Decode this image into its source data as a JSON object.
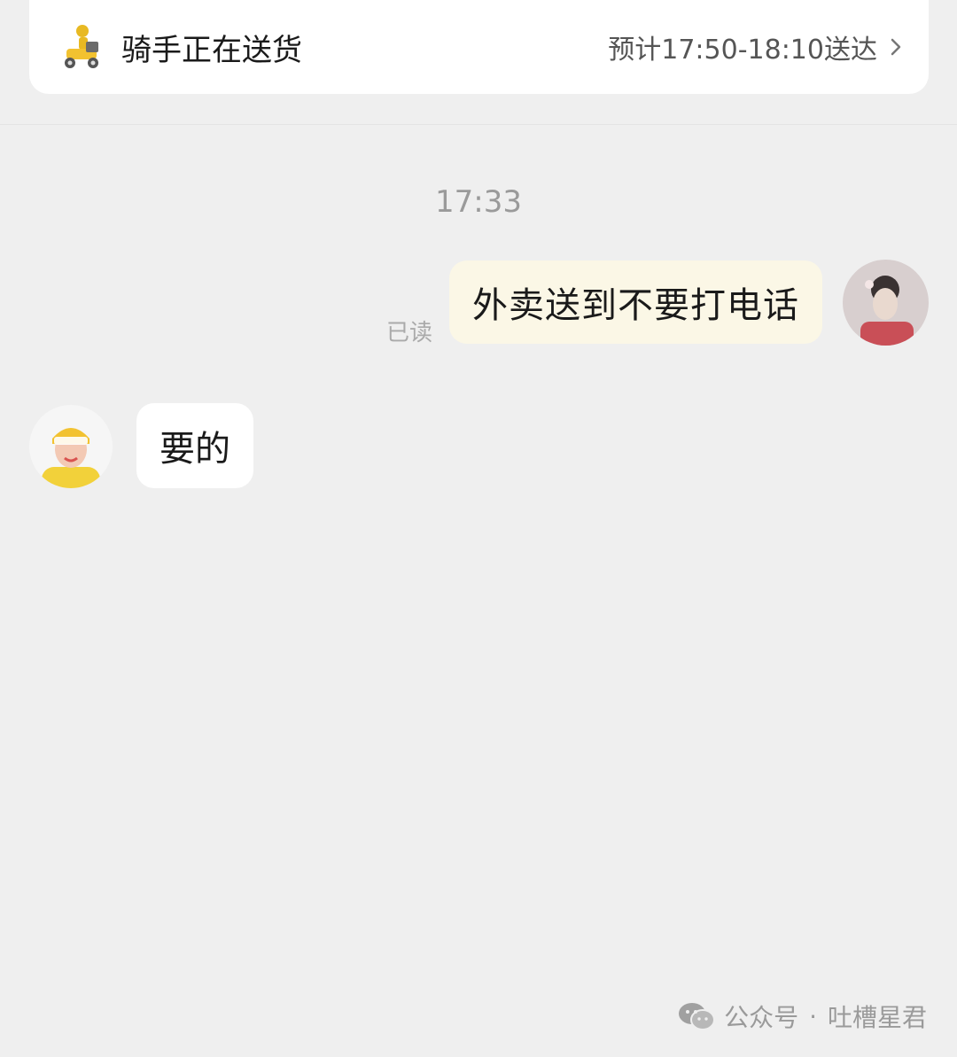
{
  "status": {
    "title": "骑手正在送货",
    "eta": "预计17:50-18:10送达",
    "icon": "scooter-icon"
  },
  "chat": {
    "timestamp": "17:33",
    "messages": [
      {
        "side": "out",
        "text": "外卖送到不要打电话",
        "read_label": "已读"
      },
      {
        "side": "in",
        "text": "要的"
      }
    ]
  },
  "watermark": {
    "prefix": "公众号",
    "separator": "·",
    "name": "吐槽星君"
  },
  "colors": {
    "background": "#efefef",
    "outgoing_bubble": "#fbf7e6",
    "incoming_bubble": "#ffffff",
    "brand_yellow": "#f2c230"
  }
}
